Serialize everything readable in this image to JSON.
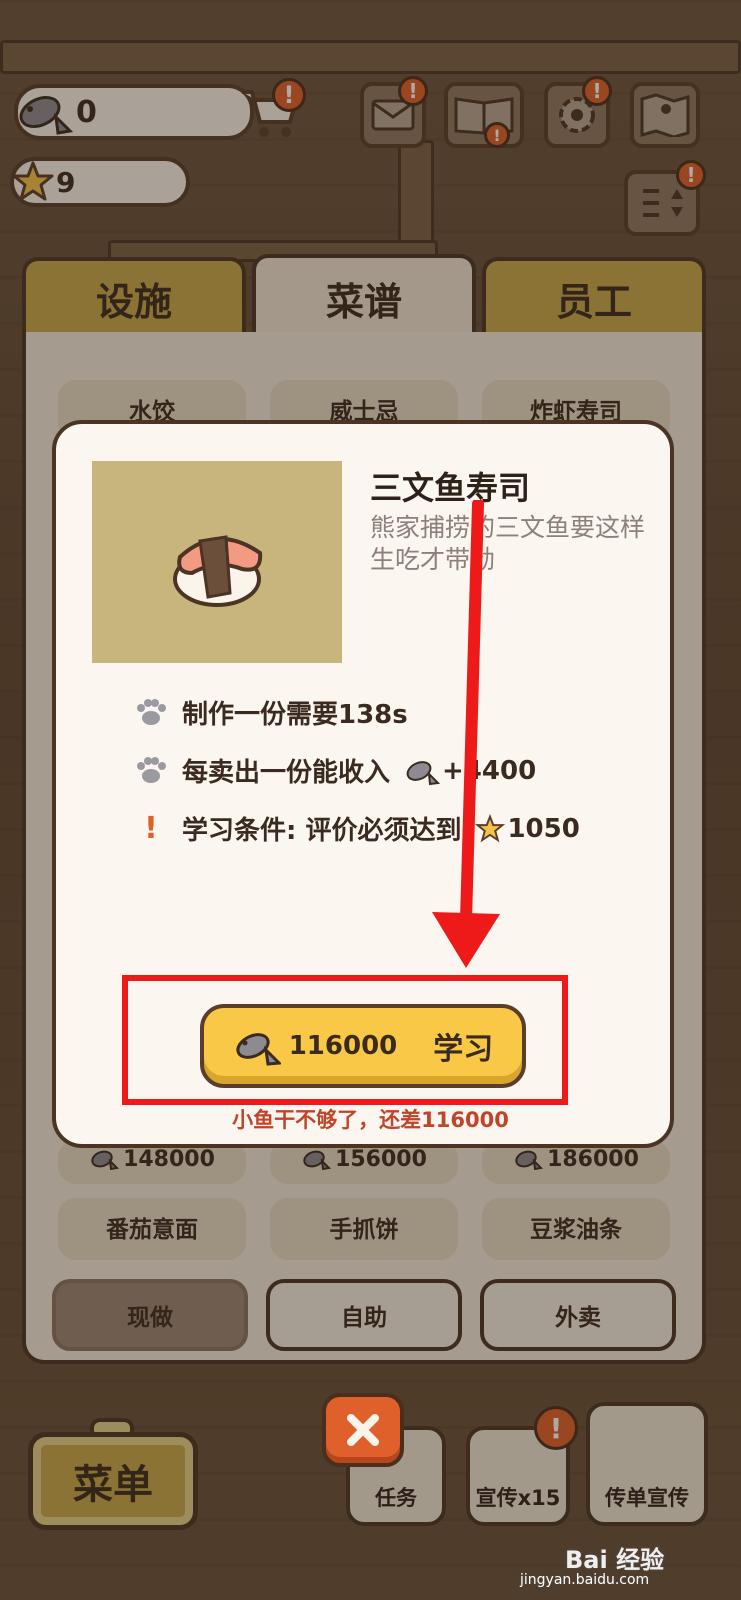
{
  "currency": {
    "fish_amount": "0",
    "star_amount": "9"
  },
  "tabs": [
    {
      "label": "设施",
      "active": false
    },
    {
      "label": "菜谱",
      "active": true
    },
    {
      "label": "员工",
      "active": false
    }
  ],
  "recipes_row1": [
    {
      "name": "水饺"
    },
    {
      "name": "威士忌"
    },
    {
      "name": "炸虾寿司"
    }
  ],
  "recipes_prices": [
    {
      "price": "148000"
    },
    {
      "price": "156000"
    },
    {
      "price": "186000"
    }
  ],
  "recipes_row3": [
    {
      "name": "番茄意面"
    },
    {
      "name": "手抓饼"
    },
    {
      "name": "豆浆油条"
    }
  ],
  "modes": {
    "fresh": "现做",
    "buffet": "自助",
    "takeout": "外卖"
  },
  "modal": {
    "title": "三文鱼寿司",
    "description": "熊家捕捞的三文鱼要这样生吃才带劲",
    "make_time": "制作一份需要138s",
    "income_label": "每卖出一份能收入",
    "income_value": "+4400",
    "requirement_label": "学习条件: 评价必须达到",
    "requirement_value": "1050",
    "learn_cost": "116000",
    "learn_label": "学习",
    "warning": "小鱼干不够了，还差116000"
  },
  "bottom": {
    "menu_label": "菜单",
    "task_label": "任务",
    "promo_label": "宣传x15",
    "flyer_label": "传单宣传"
  },
  "watermark": {
    "brand": "Bai 经验",
    "url": "jingyan.baidu.com"
  },
  "colors": {
    "accent_yellow": "#f9c846",
    "tab_gold": "#c9a94b",
    "badge_orange": "#e0602b",
    "annotation_red": "#ee1a1a",
    "warning_red": "#c0442a"
  },
  "icons": [
    "fish-icon",
    "star-icon",
    "cart-icon",
    "mail-icon",
    "recipe-book-icon",
    "gear-icon",
    "map-icon",
    "sort-icon",
    "paw-icon",
    "exclamation-icon",
    "close-icon"
  ]
}
